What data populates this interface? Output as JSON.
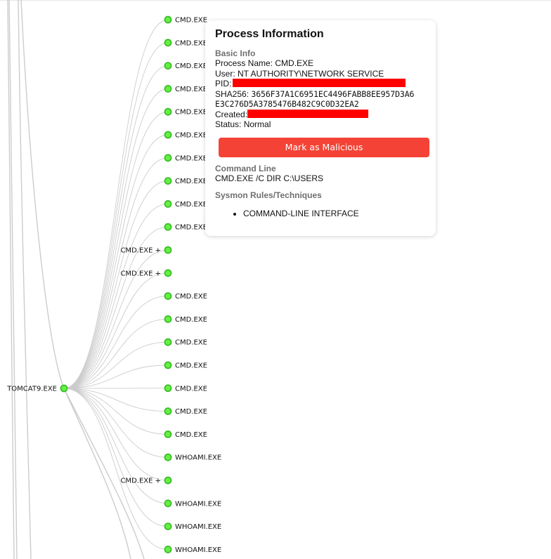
{
  "tree": {
    "root": {
      "label": "TOMCAT9.EXE",
      "collapsed": false
    },
    "children": [
      {
        "label": "CMD.EXE",
        "collapsed": false
      },
      {
        "label": "CMD.EXE",
        "collapsed": false
      },
      {
        "label": "CMD.EXE",
        "collapsed": false
      },
      {
        "label": "CMD.EXE",
        "collapsed": false
      },
      {
        "label": "CMD.EXE",
        "collapsed": false
      },
      {
        "label": "CMD.EXE",
        "collapsed": false
      },
      {
        "label": "CMD.EXE",
        "collapsed": false
      },
      {
        "label": "CMD.EXE",
        "collapsed": false
      },
      {
        "label": "CMD.EXE",
        "collapsed": false
      },
      {
        "label": "CMD.EXE",
        "collapsed": false
      },
      {
        "label": "CMD.EXE +",
        "collapsed": true
      },
      {
        "label": "CMD.EXE +",
        "collapsed": true
      },
      {
        "label": "CMD.EXE",
        "collapsed": false
      },
      {
        "label": "CMD.EXE",
        "collapsed": false
      },
      {
        "label": "CMD.EXE",
        "collapsed": false
      },
      {
        "label": "CMD.EXE",
        "collapsed": false
      },
      {
        "label": "CMD.EXE",
        "collapsed": false
      },
      {
        "label": "CMD.EXE",
        "collapsed": false
      },
      {
        "label": "CMD.EXE",
        "collapsed": false
      },
      {
        "label": "WHOAMI.EXE",
        "collapsed": false
      },
      {
        "label": "CMD.EXE +",
        "collapsed": true
      },
      {
        "label": "WHOAMI.EXE",
        "collapsed": false
      },
      {
        "label": "WHOAMI.EXE",
        "collapsed": false
      },
      {
        "label": "WHOAMI.EXE",
        "collapsed": false
      }
    ],
    "colors": {
      "node_fill": "#66ee44",
      "node_stroke": "#33bb22",
      "link": "#cccccc"
    }
  },
  "panel": {
    "title": "Process Information",
    "basic": {
      "heading": "Basic Info",
      "process_name_label": "Process Name: ",
      "process_name": "CMD.EXE",
      "user_label": "User: ",
      "user": "NT AUTHORITY\\NETWORK SERVICE",
      "pid_label": "PID: ",
      "sha_label": "SHA256: ",
      "sha_line1": "3656F37A1C6951EC4496FABB8EE957D3A6",
      "sha_line2": "E3C276D5A3785476B482C9C0D32EA2",
      "created_label": "Created: ",
      "status_label": "Status: ",
      "status": "Normal"
    },
    "mark_button": "Mark as Malicious",
    "command": {
      "heading": "Command Line",
      "value": "CMD.EXE /C DIR C:\\USERS"
    },
    "rules": {
      "heading": "Sysmon Rules/Techniques",
      "items": [
        "COMMAND-LINE INTERFACE"
      ]
    },
    "colors": {
      "button": "#f44336",
      "redaction": "#ff0000",
      "section_heading": "#6f6f6f"
    }
  }
}
